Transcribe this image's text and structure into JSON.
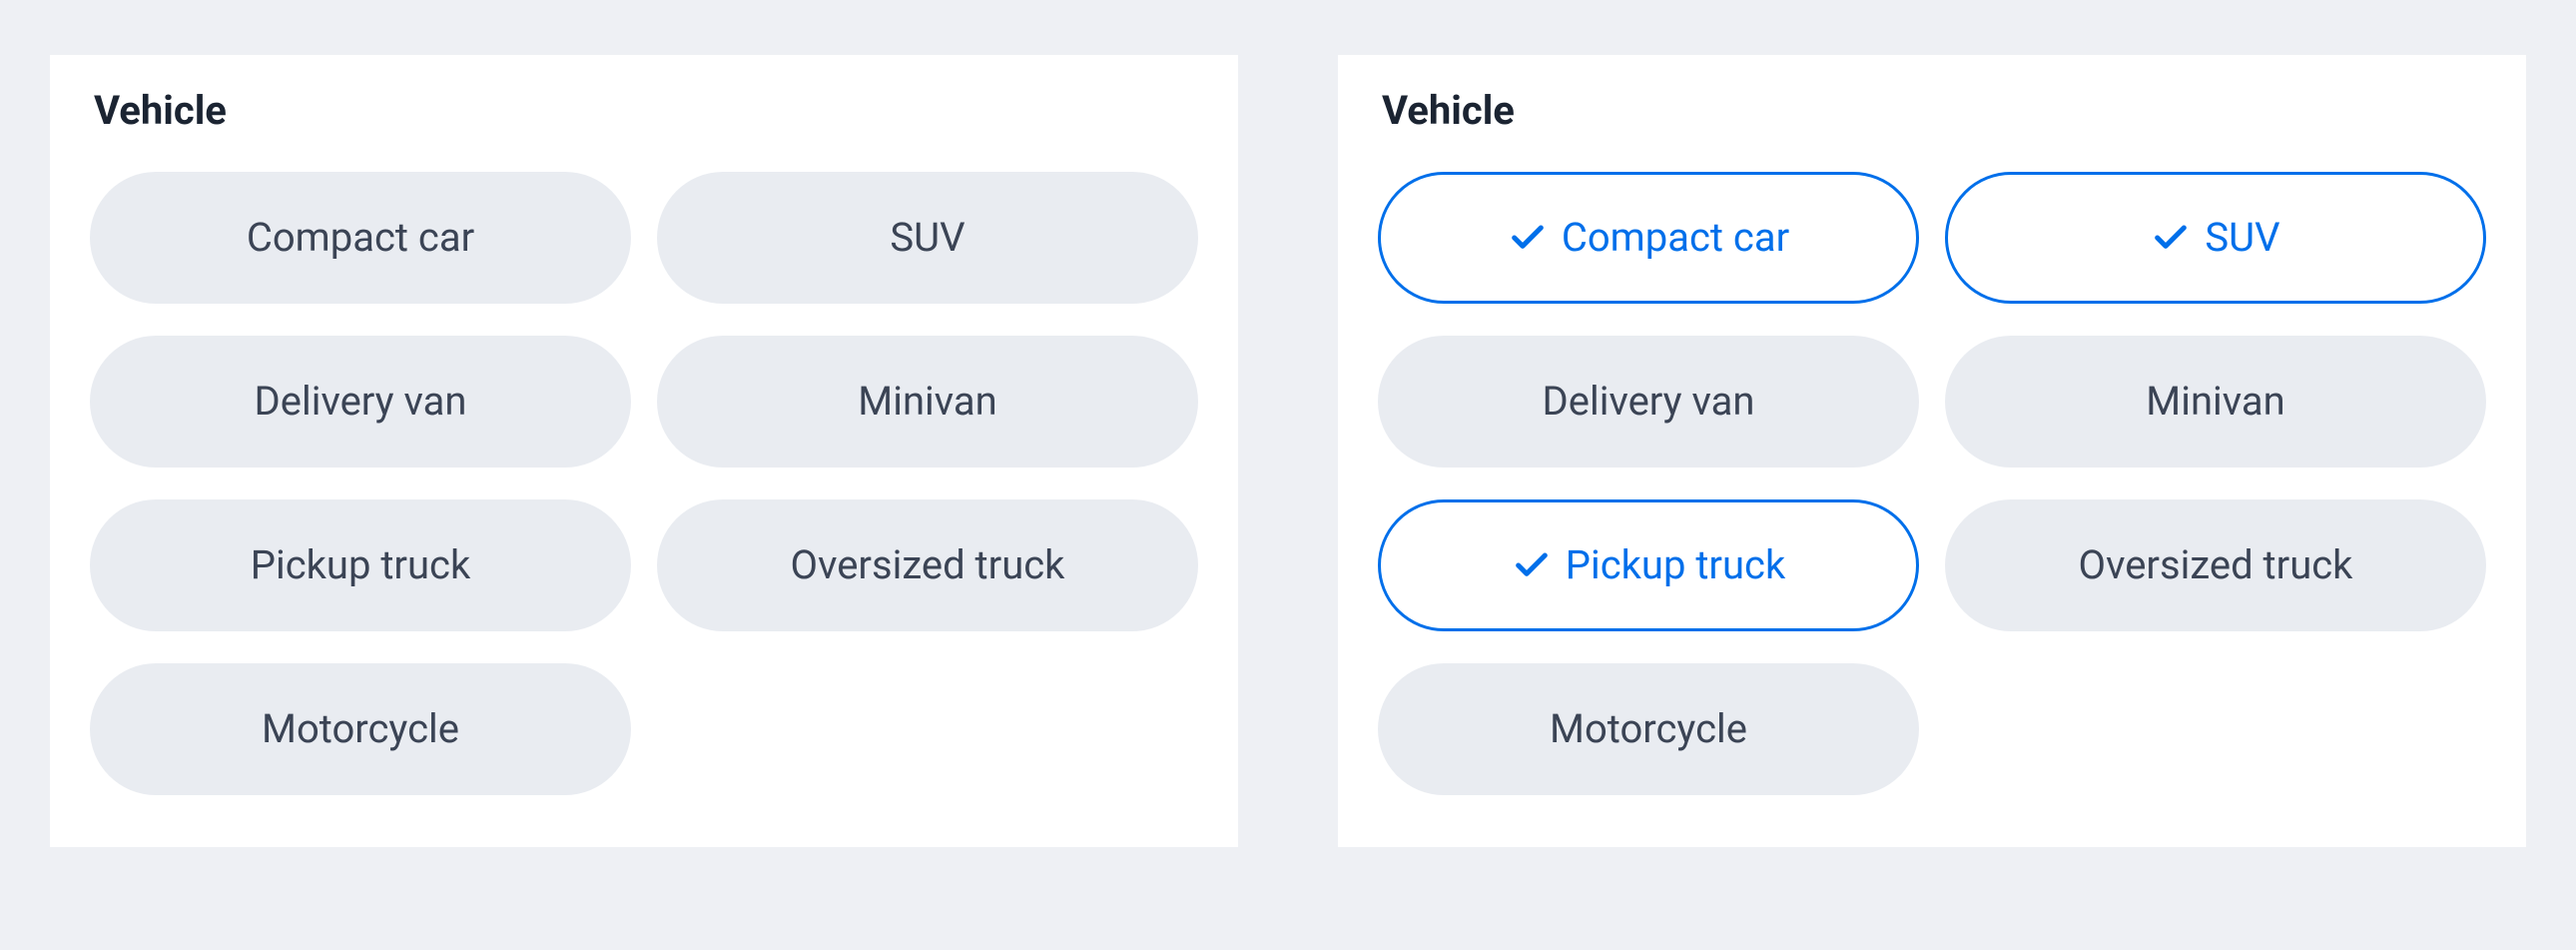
{
  "panels": [
    {
      "title": "Vehicle",
      "chips": [
        {
          "label": "Compact car",
          "selected": false
        },
        {
          "label": "SUV",
          "selected": false
        },
        {
          "label": "Delivery van",
          "selected": false
        },
        {
          "label": "Minivan",
          "selected": false
        },
        {
          "label": "Pickup truck",
          "selected": false
        },
        {
          "label": "Oversized truck",
          "selected": false
        },
        {
          "label": "Motorcycle",
          "selected": false
        }
      ]
    },
    {
      "title": "Vehicle",
      "chips": [
        {
          "label": "Compact car",
          "selected": true
        },
        {
          "label": "SUV",
          "selected": true
        },
        {
          "label": "Delivery van",
          "selected": false
        },
        {
          "label": "Minivan",
          "selected": false
        },
        {
          "label": "Pickup truck",
          "selected": true
        },
        {
          "label": "Oversized truck",
          "selected": false
        },
        {
          "label": "Motorcycle",
          "selected": false
        }
      ]
    }
  ],
  "colors": {
    "accent": "#006fea",
    "chipBg": "#e9ecf1",
    "text": "#3b4455",
    "pageBg": "#eef0f4"
  }
}
